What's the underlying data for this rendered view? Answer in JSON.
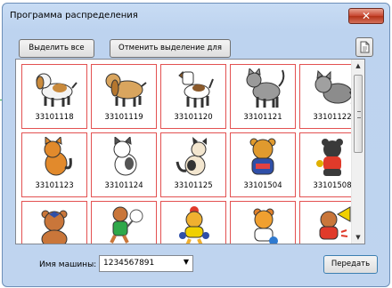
{
  "window": {
    "title": "Программа распределения",
    "close_glyph": "✕"
  },
  "toolbar": {
    "select_all": "Выделить все",
    "deselect_all": "Отменить выделение для всех",
    "doc_icon": "document-icon"
  },
  "items": [
    {
      "code": "33101118",
      "icon": "dog-icon"
    },
    {
      "code": "33101119",
      "icon": "dog-icon"
    },
    {
      "code": "33101120",
      "icon": "dog-icon"
    },
    {
      "code": "33101121",
      "icon": "cat-icon"
    },
    {
      "code": "33101122",
      "icon": "cat-icon"
    },
    {
      "code": "33101123",
      "icon": "cat-icon"
    },
    {
      "code": "33101124",
      "icon": "cat-icon"
    },
    {
      "code": "33101125",
      "icon": "cat-icon"
    },
    {
      "code": "33101504",
      "icon": "bear-icon"
    },
    {
      "code": "33101508",
      "icon": "bear-icon"
    },
    {
      "code": "",
      "icon": "bear-icon"
    },
    {
      "code": "",
      "icon": "bear-icon"
    },
    {
      "code": "",
      "icon": "bear-icon"
    },
    {
      "code": "",
      "icon": "bear-icon"
    },
    {
      "code": "",
      "icon": "bear-icon"
    }
  ],
  "machine": {
    "label": "Имя машины:",
    "value": "1234567891"
  },
  "send_button": "Передать",
  "colors": {
    "selection_border": "#e35151",
    "title_bg": "#bdd3ef",
    "close_red": "#c7452f"
  }
}
